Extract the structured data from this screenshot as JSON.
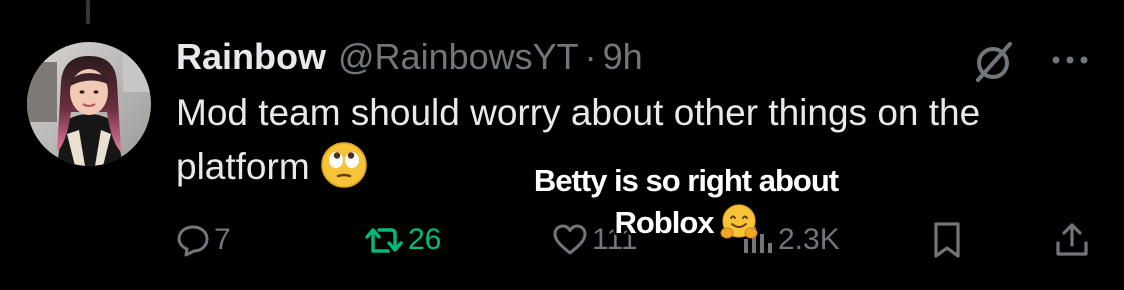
{
  "tweet": {
    "display_name": "Rainbow",
    "handle": "@RainbowsYT",
    "separator": "·",
    "time": "9h",
    "text": "Mod team should worry about other things on the platform",
    "text_emoji": "face-with-rolling-eyes-emoji"
  },
  "metrics": {
    "replies": "7",
    "reposts": "26",
    "likes": "111",
    "views": "2.3K"
  },
  "caption": {
    "line1": "Betty is so right about",
    "line2": "Roblox",
    "emoji": "hugging-face-emoji"
  },
  "colors": {
    "background": "#000000",
    "text_primary": "#e7e9ea",
    "text_secondary": "#71767b",
    "repost_active": "#00ba7c",
    "caption_text": "#ffffff"
  },
  "icons": [
    "grok-icon",
    "more-icon",
    "reply-icon",
    "repost-icon",
    "like-icon",
    "views-icon",
    "bookmark-icon",
    "share-icon"
  ]
}
